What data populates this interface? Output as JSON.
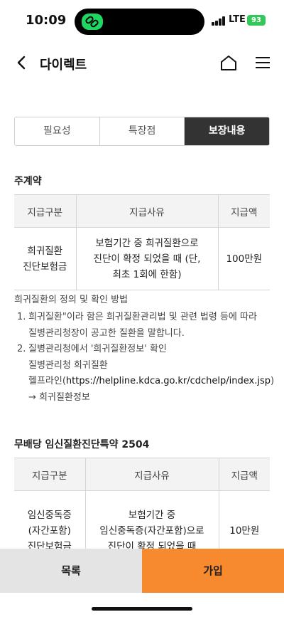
{
  "status": {
    "time": "10:09",
    "network": "LTE",
    "battery": "93"
  },
  "header": {
    "title": "다이렉트",
    "icons": [
      "back-icon",
      "home-icon",
      "menu-icon"
    ]
  },
  "tabs": [
    {
      "label": "필요성",
      "active": false
    },
    {
      "label": "특장점",
      "active": false
    },
    {
      "label": "보장내용",
      "active": true
    }
  ],
  "main_contract": {
    "title": "주계약",
    "headers": [
      "지급구분",
      "지급사유",
      "지급액"
    ],
    "rows": [
      {
        "category": "희귀질환\n진단보험금",
        "reason": "보험기간 중 희귀질환으로\n진단이 확정 되었을 때 (단,\n최초 1회에 한함)",
        "amount": "100만원"
      }
    ]
  },
  "notes": {
    "title": "희귀질환의 정의 및 확인 방법",
    "items": [
      {
        "num": "1.",
        "text": "희귀질환\"이라 함은 희귀질환관리법 및 관련 법령 등에 따라\n질병관리청장이 공고한 질환을 말합니다."
      },
      {
        "num": "2.",
        "text": "질병관리청에서 '희귀질환정보' 확인\n질병관리청 희귀질환\n헬프라인(",
        "link": "https://helpline.kdca.go.kr/cdchelp/index.jsp",
        "after": ")",
        "extra": "→ 희귀질환정보"
      }
    ]
  },
  "rider": {
    "title": "무배당 임신질환진단특약 2504",
    "headers": [
      "지급구분",
      "지급사유",
      "지급액"
    ],
    "rows": [
      {
        "category": "임신중독증\n(자간포함)\n진단보험금",
        "reason": "보험기간 중\n임신중독증(자간포함)으로\n진단이 확정 되었을 때",
        "amount": "10만원"
      }
    ]
  },
  "bottom": {
    "list_label": "목록",
    "join_label": "가입"
  },
  "colors": {
    "accent": "#f78a2f",
    "tab_active": "#333333"
  }
}
